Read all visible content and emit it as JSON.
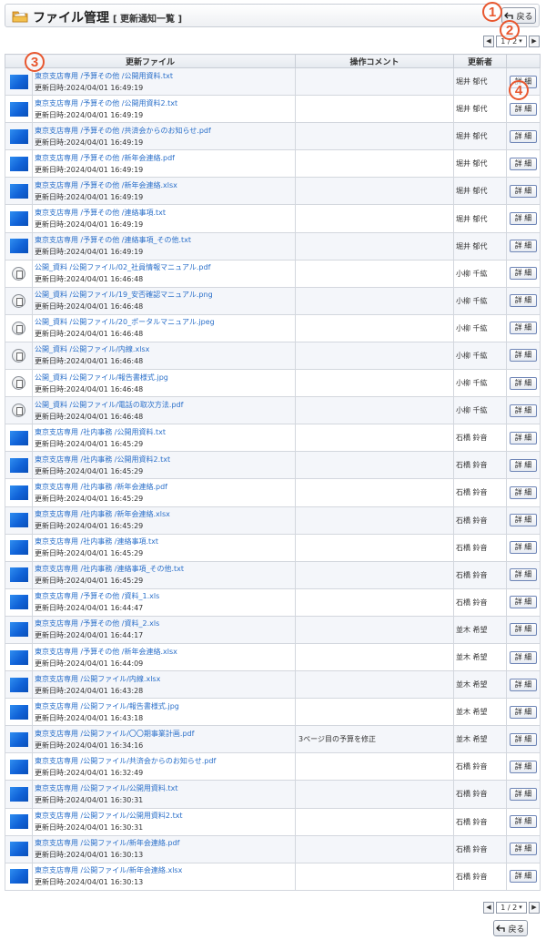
{
  "header": {
    "title": "ファイル管理",
    "subtitle": "[ 更新通知一覧 ]",
    "back_label": "戻る"
  },
  "pager": {
    "value": "1 / 2",
    "prev": "◀",
    "next": "▶"
  },
  "table": {
    "columns": [
      "更新ファイル",
      "操作コメント",
      "更新者"
    ],
    "detail_label": "詳 細",
    "rows": [
      {
        "icon": "blue",
        "path": "東京支店専用 /予算その他 /公開用資料.txt",
        "date": "更新日時:2024/04/01 16:49:19",
        "comment": "",
        "user": "堀井 郁代"
      },
      {
        "icon": "blue",
        "path": "東京支店専用 /予算その他 /公開用資料2.txt",
        "date": "更新日時:2024/04/01 16:49:19",
        "comment": "",
        "user": "堀井 郁代"
      },
      {
        "icon": "blue",
        "path": "東京支店専用 /予算その他 /共済会からのお知らせ.pdf",
        "date": "更新日時:2024/04/01 16:49:19",
        "comment": "",
        "user": "堀井 郁代"
      },
      {
        "icon": "blue",
        "path": "東京支店専用 /予算その他 /新年会連絡.pdf",
        "date": "更新日時:2024/04/01 16:49:19",
        "comment": "",
        "user": "堀井 郁代"
      },
      {
        "icon": "blue",
        "path": "東京支店専用 /予算その他 /新年会連絡.xlsx",
        "date": "更新日時:2024/04/01 16:49:19",
        "comment": "",
        "user": "堀井 郁代"
      },
      {
        "icon": "blue",
        "path": "東京支店専用 /予算その他 /連絡事項.txt",
        "date": "更新日時:2024/04/01 16:49:19",
        "comment": "",
        "user": "堀井 郁代"
      },
      {
        "icon": "blue",
        "path": "東京支店専用 /予算その他 /連絡事項_その他.txt",
        "date": "更新日時:2024/04/01 16:49:19",
        "comment": "",
        "user": "堀井 郁代"
      },
      {
        "icon": "doc",
        "path": "公開_資料 /公開ファイル/02_社員情報マニュアル.pdf",
        "date": "更新日時:2024/04/01 16:46:48",
        "comment": "",
        "user": "小柳 千紘"
      },
      {
        "icon": "doc",
        "path": "公開_資料 /公開ファイル/19_安否確認マニュアル.png",
        "date": "更新日時:2024/04/01 16:46:48",
        "comment": "",
        "user": "小柳 千紘"
      },
      {
        "icon": "doc",
        "path": "公開_資料 /公開ファイル/20_ポータルマニュアル.jpeg",
        "date": "更新日時:2024/04/01 16:46:48",
        "comment": "",
        "user": "小柳 千紘"
      },
      {
        "icon": "doc",
        "path": "公開_資料 /公開ファイル/内線.xlsx",
        "date": "更新日時:2024/04/01 16:46:48",
        "comment": "",
        "user": "小柳 千紘"
      },
      {
        "icon": "doc",
        "path": "公開_資料 /公開ファイル/報告書様式.jpg",
        "date": "更新日時:2024/04/01 16:46:48",
        "comment": "",
        "user": "小柳 千紘"
      },
      {
        "icon": "doc",
        "path": "公開_資料 /公開ファイル/電話の取次方法.pdf",
        "date": "更新日時:2024/04/01 16:46:48",
        "comment": "",
        "user": "小柳 千紘"
      },
      {
        "icon": "blue",
        "path": "東京支店専用 /社内事務 /公開用資料.txt",
        "date": "更新日時:2024/04/01 16:45:29",
        "comment": "",
        "user": "石橋 鈴音"
      },
      {
        "icon": "blue",
        "path": "東京支店専用 /社内事務 /公開用資料2.txt",
        "date": "更新日時:2024/04/01 16:45:29",
        "comment": "",
        "user": "石橋 鈴音"
      },
      {
        "icon": "blue",
        "path": "東京支店専用 /社内事務 /新年会連絡.pdf",
        "date": "更新日時:2024/04/01 16:45:29",
        "comment": "",
        "user": "石橋 鈴音"
      },
      {
        "icon": "blue",
        "path": "東京支店専用 /社内事務 /新年会連絡.xlsx",
        "date": "更新日時:2024/04/01 16:45:29",
        "comment": "",
        "user": "石橋 鈴音"
      },
      {
        "icon": "blue",
        "path": "東京支店専用 /社内事務 /連絡事項.txt",
        "date": "更新日時:2024/04/01 16:45:29",
        "comment": "",
        "user": "石橋 鈴音"
      },
      {
        "icon": "blue",
        "path": "東京支店専用 /社内事務 /連絡事項_その他.txt",
        "date": "更新日時:2024/04/01 16:45:29",
        "comment": "",
        "user": "石橋 鈴音"
      },
      {
        "icon": "blue",
        "path": "東京支店専用 /予算その他 /資料_1.xls",
        "date": "更新日時:2024/04/01 16:44:47",
        "comment": "",
        "user": "石橋 鈴音"
      },
      {
        "icon": "blue",
        "path": "東京支店専用 /予算その他 /資料_2.xls",
        "date": "更新日時:2024/04/01 16:44:17",
        "comment": "",
        "user": "並木 希望"
      },
      {
        "icon": "blue",
        "path": "東京支店専用 /予算その他 /新年会連絡.xlsx",
        "date": "更新日時:2024/04/01 16:44:09",
        "comment": "",
        "user": "並木 希望"
      },
      {
        "icon": "blue",
        "path": "東京支店専用 /公開ファイル/内線.xlsx",
        "date": "更新日時:2024/04/01 16:43:28",
        "comment": "",
        "user": "並木 希望"
      },
      {
        "icon": "blue",
        "path": "東京支店専用 /公開ファイル/報告書様式.jpg",
        "date": "更新日時:2024/04/01 16:43:18",
        "comment": "",
        "user": "並木 希望"
      },
      {
        "icon": "blue",
        "path": "東京支店専用 /公開ファイル/〇〇期事業計画.pdf",
        "date": "更新日時:2024/04/01 16:34:16",
        "comment": "3ページ目の予算を修正",
        "user": "並木 希望"
      },
      {
        "icon": "blue",
        "path": "東京支店専用 /公開ファイル/共済会からのお知らせ.pdf",
        "date": "更新日時:2024/04/01 16:32:49",
        "comment": "",
        "user": "石橋 鈴音"
      },
      {
        "icon": "blue",
        "path": "東京支店専用 /公開ファイル/公開用資料.txt",
        "date": "更新日時:2024/04/01 16:30:31",
        "comment": "",
        "user": "石橋 鈴音"
      },
      {
        "icon": "blue",
        "path": "東京支店専用 /公開ファイル/公開用資料2.txt",
        "date": "更新日時:2024/04/01 16:30:31",
        "comment": "",
        "user": "石橋 鈴音"
      },
      {
        "icon": "blue",
        "path": "東京支店専用 /公開ファイル/新年会連絡.pdf",
        "date": "更新日時:2024/04/01 16:30:13",
        "comment": "",
        "user": "石橋 鈴音"
      },
      {
        "icon": "blue",
        "path": "東京支店専用 /公開ファイル/新年会連絡.xlsx",
        "date": "更新日時:2024/04/01 16:30:13",
        "comment": "",
        "user": "石橋 鈴音"
      }
    ]
  },
  "annotations": [
    "1",
    "2",
    "3",
    "4"
  ],
  "colors": {
    "accent": "#2a6fc9",
    "badge": "#e8572f"
  }
}
